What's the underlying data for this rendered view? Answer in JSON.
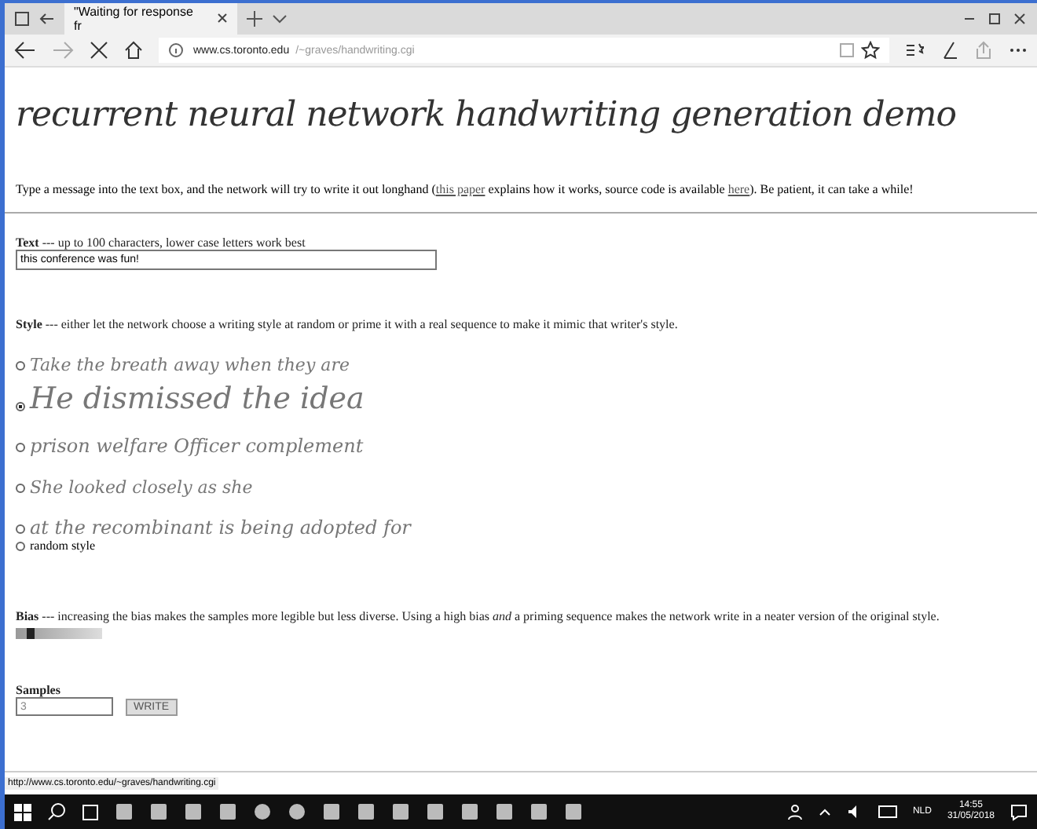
{
  "browser": {
    "tab_title": "\"Waiting for response fr",
    "address_host": "www.cs.toronto.edu",
    "address_path": "/~graves/handwriting.cgi"
  },
  "page": {
    "title": "recurrent neural network handwriting generation demo",
    "intro": {
      "before": "Type a message into the text box, and the network will try to write it out longhand (",
      "link1": "this paper",
      "middle": " explains how it works, source code is available ",
      "link2": "here",
      "after": "). Be patient, it can take a while!"
    },
    "text_label": "Text",
    "text_hint": " --- up to 100 characters, lower case letters work best",
    "text_value": "this conference was fun!",
    "style_label": "Style",
    "style_hint": " --- either let the network choose a writing style at random or prime it with a real sequence to make it mimic that writer's style.",
    "styles": [
      {
        "kind": "sample",
        "text": "Take the breath away when they are",
        "selected": false
      },
      {
        "kind": "sample",
        "text": "He dismissed the idea",
        "selected": true
      },
      {
        "kind": "sample",
        "text": "prison welfare Officer complement",
        "selected": false
      },
      {
        "kind": "sample",
        "text": "She looked closely as she",
        "selected": false
      },
      {
        "kind": "sample",
        "text": "at the recombinant is being adopted for",
        "selected": false
      },
      {
        "kind": "plain",
        "text": "random style",
        "selected": false
      }
    ],
    "bias_label": "Bias",
    "bias_hint": " --- increasing the bias makes the samples more legible but less diverse. Using a high bias *and* a priming sequence makes the network write in a neater version of the original style.",
    "bias": {
      "level": 0.12
    },
    "samples_label": "Samples",
    "samples_value": "3",
    "write_button": "WRITE"
  },
  "status_url": "http://www.cs.toronto.edu/~graves/handwriting.cgi",
  "taskbar": {
    "language": "NLD",
    "time": "14:55",
    "date": "31/05/2018"
  }
}
